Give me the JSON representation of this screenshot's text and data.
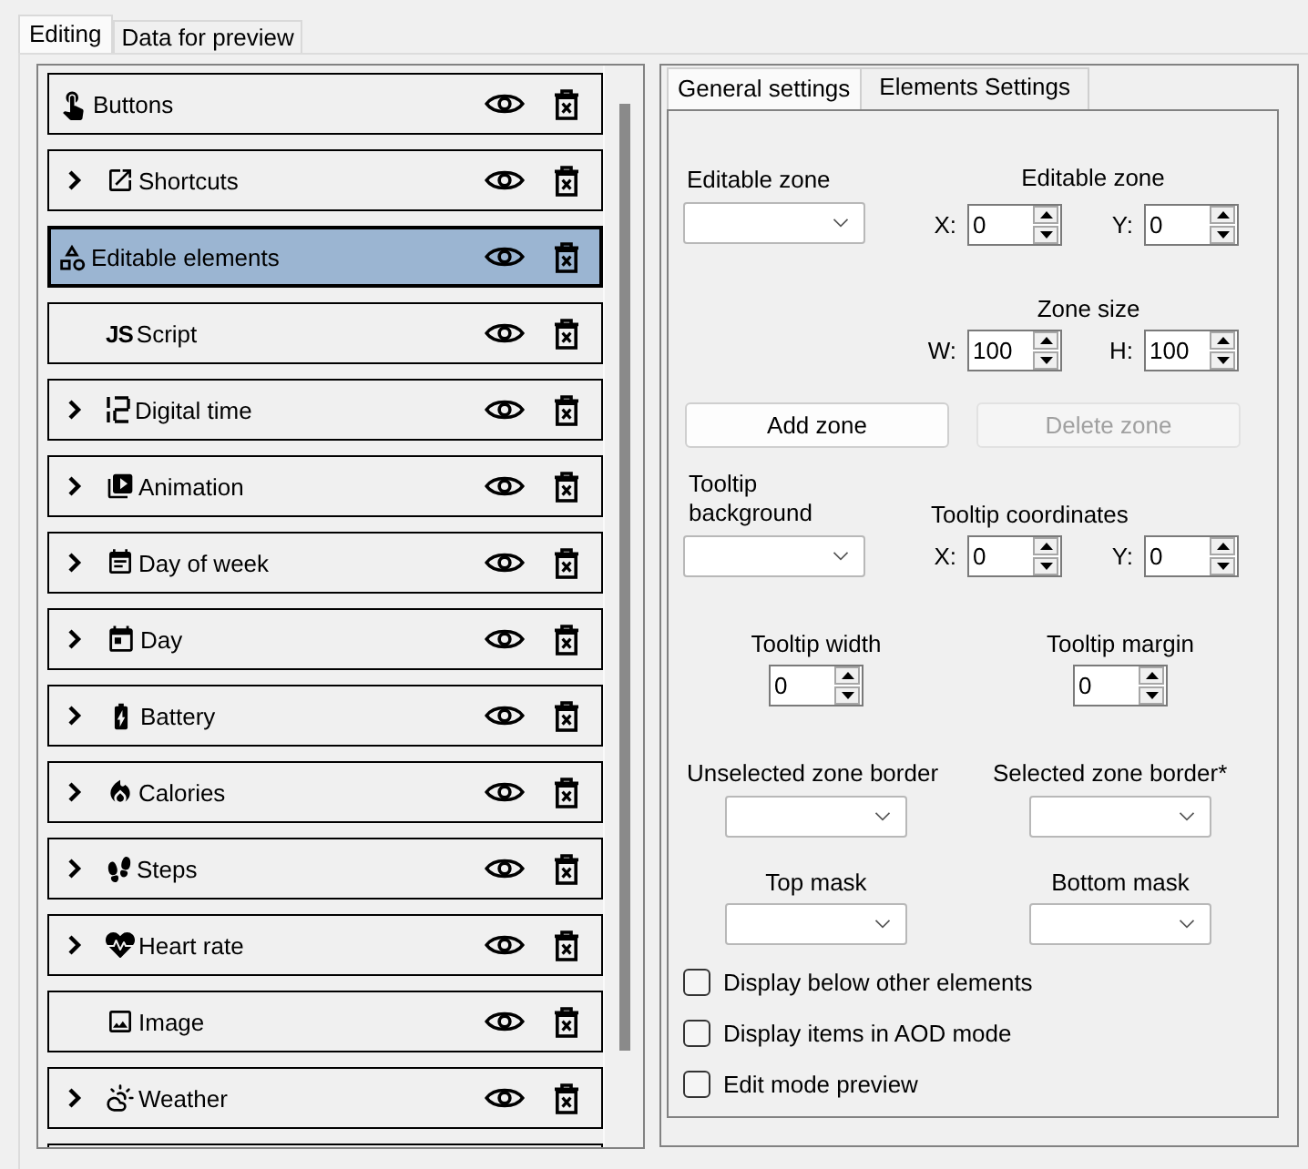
{
  "tabs": [
    {
      "label": "Editing",
      "selected": true
    },
    {
      "label": "Data for preview",
      "selected": false
    }
  ],
  "elements": [
    {
      "label": "Buttons",
      "kind": "root",
      "selected": false
    },
    {
      "label": "Shortcuts",
      "kind": "branch",
      "selected": false
    },
    {
      "label": "Editable elements",
      "kind": "root",
      "selected": true
    },
    {
      "label": "Script",
      "kind": "leaf",
      "icon_text": "JS",
      "selected": false
    },
    {
      "label": "Digital time",
      "kind": "branch",
      "selected": false
    },
    {
      "label": "Animation",
      "kind": "branch",
      "selected": false
    },
    {
      "label": "Day of week",
      "kind": "branch",
      "selected": false
    },
    {
      "label": "Day",
      "kind": "branch",
      "selected": false
    },
    {
      "label": "Battery",
      "kind": "branch",
      "selected": false
    },
    {
      "label": "Calories",
      "kind": "branch",
      "selected": false
    },
    {
      "label": "Steps",
      "kind": "branch",
      "selected": false
    },
    {
      "label": "Heart rate",
      "kind": "branch",
      "selected": false
    },
    {
      "label": "Image",
      "kind": "leaf",
      "selected": false
    },
    {
      "label": "Weather",
      "kind": "branch",
      "selected": false
    }
  ],
  "settings": {
    "tabs": [
      {
        "label": "General settings",
        "selected": true
      },
      {
        "label": "Elements Settings",
        "selected": false
      }
    ],
    "editable_zone": {
      "label": "Editable zone"
    },
    "zone_position": {
      "label": "Editable zone",
      "x": {
        "label": "X:",
        "value": "0"
      },
      "y": {
        "label": "Y:",
        "value": "0"
      }
    },
    "zone_size": {
      "label": "Zone size",
      "w": {
        "label": "W:",
        "value": "100"
      },
      "h": {
        "label": "H:",
        "value": "100"
      }
    },
    "buttons": [
      {
        "label": "Add zone",
        "disabled": false
      },
      {
        "label": "Delete zone",
        "disabled": true
      }
    ],
    "tooltip_background": {
      "label": "Tooltip background"
    },
    "tooltip_coordinates": {
      "label": "Tooltip coordinates",
      "x": {
        "label": "X:",
        "value": "0"
      },
      "y": {
        "label": "Y:",
        "value": "0"
      }
    },
    "tooltip_width": {
      "label": "Tooltip width",
      "value": "0"
    },
    "tooltip_margin": {
      "label": "Tooltip margin",
      "value": "0"
    },
    "unselected_zone_border": {
      "label": "Unselected zone border"
    },
    "selected_zone_border": {
      "label": "Selected zone border*"
    },
    "top_mask": {
      "label": "Top mask"
    },
    "bottom_mask": {
      "label": "Bottom mask"
    },
    "checkboxes": [
      {
        "label": "Display below other elements",
        "checked": false
      },
      {
        "label": "Display items in AOD mode",
        "checked": false
      },
      {
        "label": "Edit mode preview",
        "checked": false
      }
    ]
  }
}
